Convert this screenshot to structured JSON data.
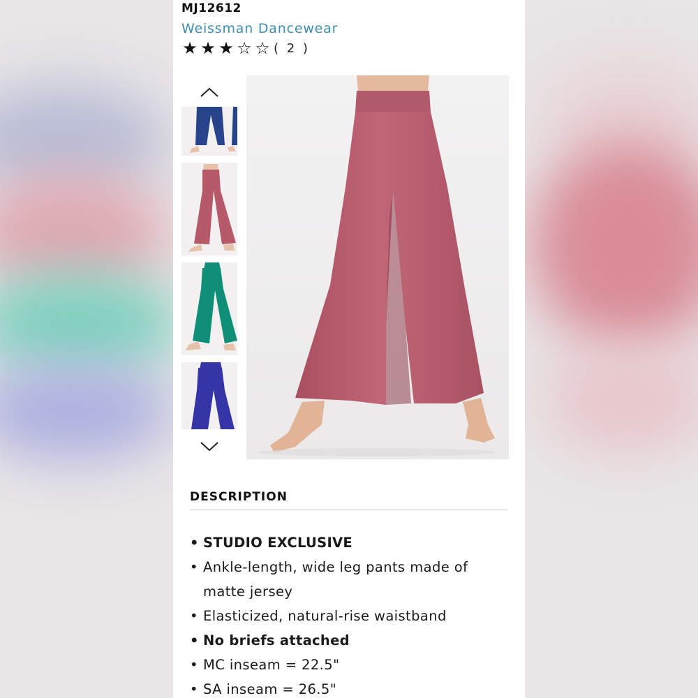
{
  "product": {
    "sku": "MJ12612",
    "brand": "Weissman Dancewear",
    "rating": {
      "filled": 3,
      "total": 5,
      "review_count": "( 2 )"
    }
  },
  "gallery": {
    "up_icon": "chevron-up-icon",
    "down_icon": "chevron-down-icon",
    "thumbnails": [
      {
        "color": "#27448a",
        "label": "navy"
      },
      {
        "color": "#b65a6a",
        "label": "rose"
      },
      {
        "color": "#0f8f78",
        "label": "teal"
      },
      {
        "color": "#3535a8",
        "label": "royal blue"
      }
    ],
    "main_color": "#b85d6c"
  },
  "description": {
    "heading": "DESCRIPTION",
    "bullets": [
      {
        "text": "STUDIO EXCLUSIVE",
        "bold": true
      },
      {
        "text": "Ankle-length, wide leg pants made of matte jersey",
        "bold": false
      },
      {
        "text": "Elasticized, natural-rise waistband",
        "bold": false
      },
      {
        "text": "No briefs attached",
        "bold": true
      },
      {
        "text": "MC inseam = 22.5\"",
        "bold": false
      },
      {
        "text": "SA inseam = 26.5\"",
        "bold": false
      }
    ]
  }
}
